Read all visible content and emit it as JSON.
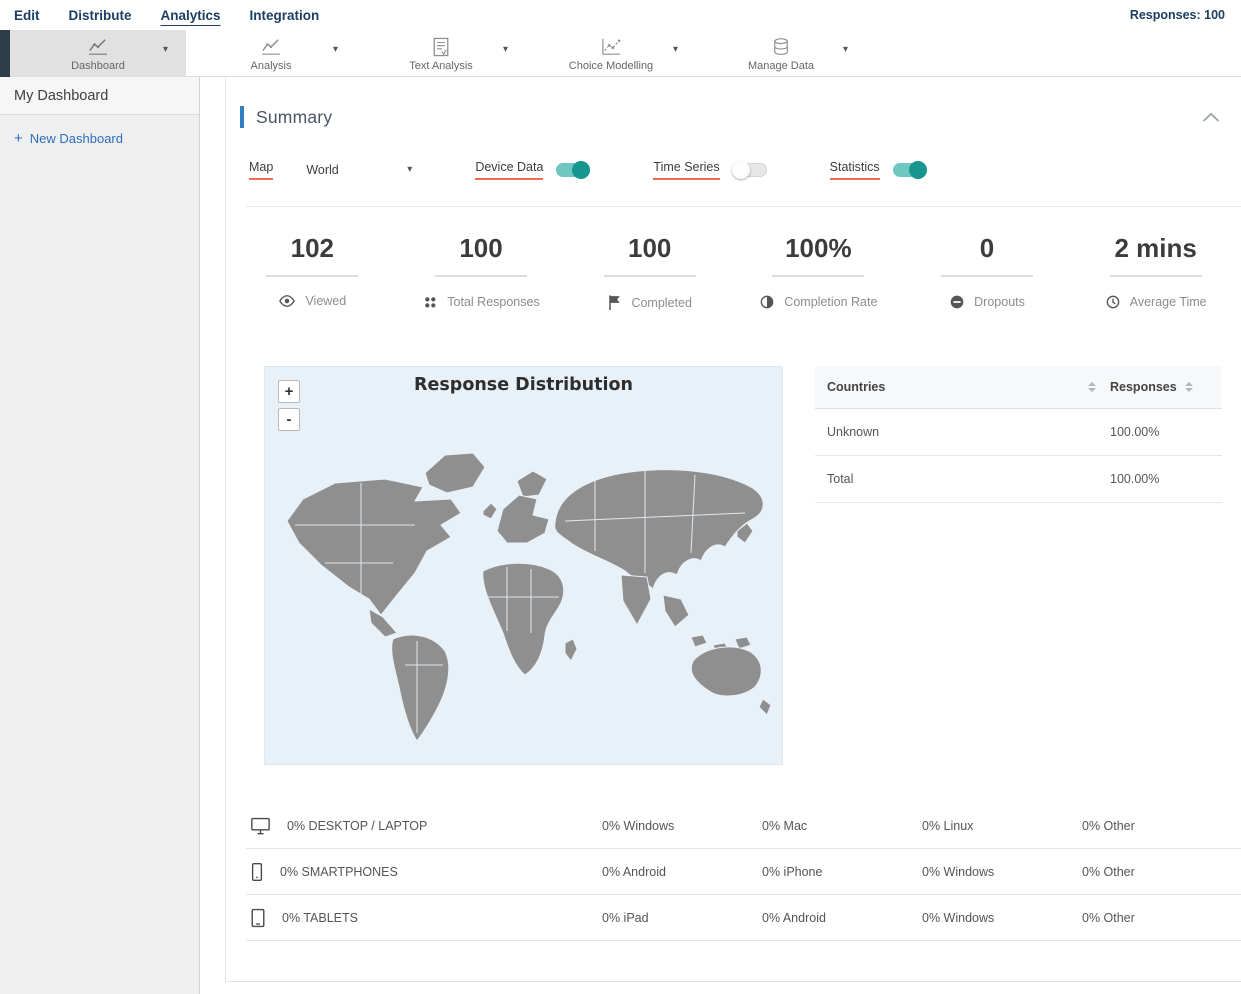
{
  "topnav": {
    "items": [
      {
        "label": "Edit"
      },
      {
        "label": "Distribute"
      },
      {
        "label": "Analytics"
      },
      {
        "label": "Integration"
      }
    ],
    "responses": "Responses: 100"
  },
  "toolbar": {
    "items": [
      {
        "label": "Dashboard",
        "icon": "line-chart-icon"
      },
      {
        "label": "Analysis",
        "icon": "line-chart-icon"
      },
      {
        "label": "Text Analysis",
        "icon": "document-icon"
      },
      {
        "label": "Choice Modelling",
        "icon": "scatter-chart-icon"
      },
      {
        "label": "Manage Data",
        "icon": "database-icon"
      }
    ]
  },
  "sidebar": {
    "my_dashboard": "My Dashboard",
    "new_dashboard_plus": "+",
    "new_dashboard": "New Dashboard"
  },
  "summary": {
    "title": "Summary",
    "controls": {
      "map_label": "Map",
      "map_value": "World",
      "device_data_label": "Device Data",
      "device_data_state": "on",
      "time_series_label": "Time Series",
      "time_series_state": "off",
      "statistics_label": "Statistics",
      "statistics_state": "on"
    },
    "stats": [
      {
        "value": "102",
        "label": "Viewed",
        "icon": "eye-icon"
      },
      {
        "value": "100",
        "label": "Total Responses",
        "icon": "dots-grid-icon"
      },
      {
        "value": "100",
        "label": "Completed",
        "icon": "flag-icon"
      },
      {
        "value": "100%",
        "label": "Completion Rate",
        "icon": "half-circle-icon"
      },
      {
        "value": "0",
        "label": "Dropouts",
        "icon": "minus-circle-icon"
      },
      {
        "value": "2 mins",
        "label": "Average Time",
        "icon": "clock-icon"
      }
    ],
    "map_panel": {
      "title": "Response Distribution",
      "zoom_in": "+",
      "zoom_out": "-"
    },
    "countries_table": {
      "col1": "Countries",
      "col2": "Responses",
      "rows": [
        {
          "country": "Unknown",
          "responses": "100.00%"
        },
        {
          "country": "Total",
          "responses": "100.00%"
        }
      ]
    },
    "device_table": {
      "rows": [
        {
          "icon": "desktop-icon",
          "label": "0% DESKTOP / LAPTOP",
          "c1": "0% Windows",
          "c2": "0% Mac",
          "c3": "0% Linux",
          "c4": "0% Other"
        },
        {
          "icon": "smartphone-icon",
          "label": "0% SMARTPHONES",
          "c1": "0% Android",
          "c2": "0% iPhone",
          "c3": "0% Windows",
          "c4": "0% Other"
        },
        {
          "icon": "tablet-icon",
          "label": "0% TABLETS",
          "c1": "0% iPad",
          "c2": "0% Android",
          "c3": "0% Windows",
          "c4": "0% Other"
        }
      ]
    }
  },
  "colors": {
    "nav_navy": "#1c3e63",
    "accent_blue": "#2f80c3",
    "accent_red": "#ef6a55",
    "toggle_teal": "#17968f",
    "map_bg": "#e9f1f8",
    "map_land": "#8f8f8f"
  }
}
